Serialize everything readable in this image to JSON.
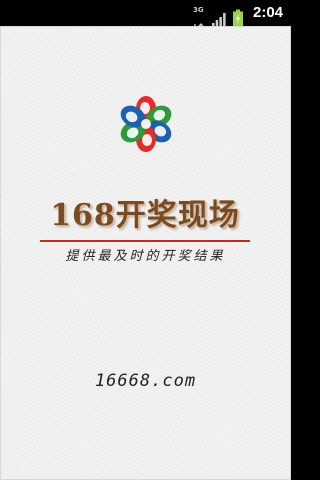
{
  "status_bar": {
    "network_label": "3G",
    "time": "2:04",
    "icons": [
      "3g-data-icon",
      "signal-strength-icon",
      "battery-charging-icon"
    ]
  },
  "splash": {
    "logo": "flower-logo-icon",
    "title": "168开奖现场",
    "tagline": "提供最及时的开奖结果",
    "website": "16668.com",
    "colors": {
      "background": "#f3f3f3",
      "title": "#7a4a22",
      "divider": "#c02a2a",
      "logo_red": "#e52a2a",
      "logo_blue": "#1e5fae",
      "logo_green": "#2c9a3a"
    }
  }
}
